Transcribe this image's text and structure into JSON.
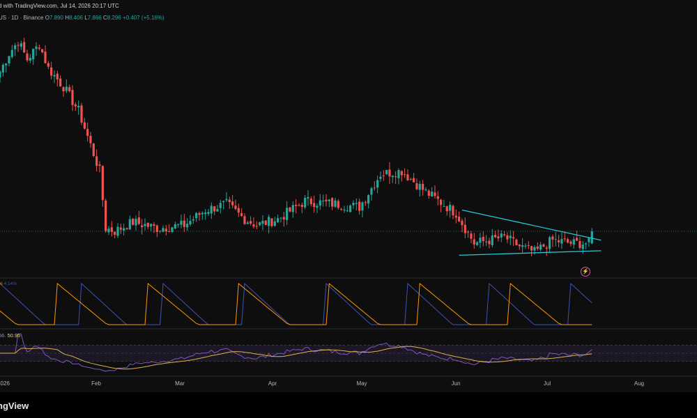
{
  "header": {
    "published": "d with TradingView.com, Jul 14, 2026 20:17 UTC",
    "symbol": "US · 1D · Binance",
    "o_label": "O",
    "o_value": "7.890",
    "h_label": "H",
    "h_value": "8.406",
    "l_label": "L",
    "l_value": "7.866",
    "c_label": "C",
    "c_value": "8.296",
    "change": "+0.407 (+5.16%)"
  },
  "aroon_label": {
    "prefix": "% ",
    "value": "4.14%"
  },
  "rsi_label": {
    "prefix": "66. ",
    "value": "50.95"
  },
  "xaxis_labels": [
    {
      "text": "2026",
      "key": "jan"
    },
    {
      "text": "Feb",
      "key": "feb"
    },
    {
      "text": "Mar",
      "key": "mar"
    },
    {
      "text": "Apr",
      "key": "apr"
    },
    {
      "text": "May",
      "key": "may"
    },
    {
      "text": "Jun",
      "key": "jun"
    },
    {
      "text": "Jul",
      "key": "jul"
    },
    {
      "text": "Aug",
      "key": "aug"
    }
  ],
  "brand": "ngView",
  "colors": {
    "up": "#26a69a",
    "down": "#ef5350",
    "trendline": "#26c6da",
    "aroon_up": "#ff9800",
    "aroon_down": "#3f51b5",
    "rsi": "#7e57c2",
    "rsi_ma": "#e0b24a"
  },
  "chart_data": {
    "type": "candlestick",
    "timeframe": "1D",
    "exchange": "Binance",
    "start_date": "2025-12-30",
    "end_date": "2026-07-14",
    "price_ylim": [
      7.0,
      15.0
    ],
    "close_path_anchors": [
      {
        "date": "2025-12-30",
        "close": 13.6
      },
      {
        "date": "2026-01-02",
        "close": 14.2
      },
      {
        "date": "2026-01-05",
        "close": 14.6
      },
      {
        "date": "2026-01-08",
        "close": 14.0
      },
      {
        "date": "2026-01-12",
        "close": 14.5
      },
      {
        "date": "2026-01-15",
        "close": 13.7
      },
      {
        "date": "2026-01-20",
        "close": 13.1
      },
      {
        "date": "2026-01-25",
        "close": 12.3
      },
      {
        "date": "2026-02-01",
        "close": 10.3
      },
      {
        "date": "2026-02-03",
        "close": 8.4
      },
      {
        "date": "2026-02-06",
        "close": 8.3
      },
      {
        "date": "2026-02-12",
        "close": 8.6
      },
      {
        "date": "2026-02-20",
        "close": 8.4
      },
      {
        "date": "2026-03-01",
        "close": 8.5
      },
      {
        "date": "2026-03-08",
        "close": 9.0
      },
      {
        "date": "2026-03-15",
        "close": 9.2
      },
      {
        "date": "2026-03-21",
        "close": 8.7
      },
      {
        "date": "2026-03-25",
        "close": 8.5
      },
      {
        "date": "2026-04-01",
        "close": 8.7
      },
      {
        "date": "2026-04-10",
        "close": 9.3
      },
      {
        "date": "2026-04-20",
        "close": 9.2
      },
      {
        "date": "2026-04-28",
        "close": 9.1
      },
      {
        "date": "2026-05-05",
        "close": 10.2
      },
      {
        "date": "2026-05-12",
        "close": 10.3
      },
      {
        "date": "2026-05-20",
        "close": 9.6
      },
      {
        "date": "2026-05-30",
        "close": 8.9
      },
      {
        "date": "2026-06-05",
        "close": 7.9
      },
      {
        "date": "2026-06-10",
        "close": 8.0
      },
      {
        "date": "2026-06-15",
        "close": 8.1
      },
      {
        "date": "2026-06-20",
        "close": 7.8
      },
      {
        "date": "2026-06-25",
        "close": 7.6
      },
      {
        "date": "2026-07-01",
        "close": 8.0
      },
      {
        "date": "2026-07-07",
        "close": 7.9
      },
      {
        "date": "2026-07-13",
        "close": 7.9
      },
      {
        "date": "2026-07-14",
        "close": 8.3
      }
    ],
    "last_candle": {
      "date": "2026-07-14",
      "open": 7.89,
      "high": 8.406,
      "low": 7.866,
      "close": 8.296
    },
    "trendlines": [
      {
        "name": "descending resistance",
        "from": {
          "date": "2026-06-01",
          "price": 9.0
        },
        "to": {
          "date": "2026-07-17",
          "price": 8.0
        }
      },
      {
        "name": "flat support",
        "from": {
          "date": "2026-05-31",
          "price": 7.5
        },
        "to": {
          "date": "2026-07-17",
          "price": 7.65
        }
      }
    ],
    "indicators": [
      {
        "name": "Aroon",
        "value_text": "4.14%",
        "ylim": [
          0,
          100
        ]
      },
      {
        "name": "RSI",
        "value_text": "50.95",
        "ylim": [
          0,
          100
        ],
        "bands": [
          30,
          70
        ]
      }
    ],
    "xaxis_ticks": [
      "2026",
      "Feb",
      "Mar",
      "Apr",
      "May",
      "Jun",
      "Jul",
      "Aug"
    ],
    "grid": false
  }
}
